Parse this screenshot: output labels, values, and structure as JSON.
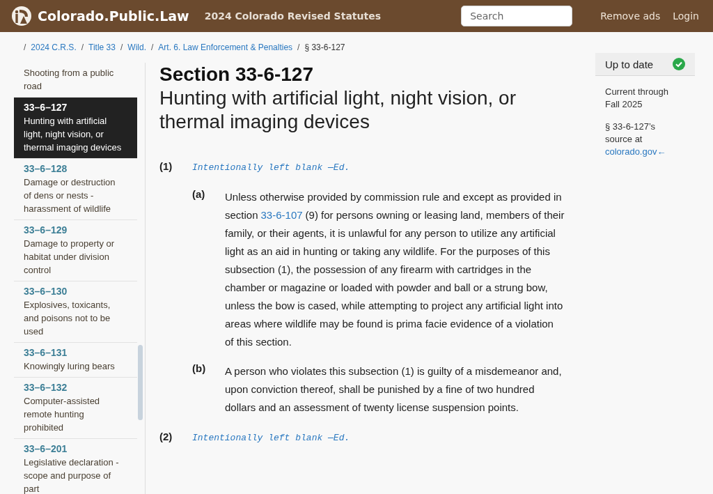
{
  "header": {
    "site_name": "Colorado.Public.Law",
    "subtitle": "2024 Colorado Revised Statutes",
    "search": {
      "placeholder": "Search"
    },
    "links": [
      "Remove ads",
      "Login"
    ]
  },
  "breadcrumb": {
    "separator": "/",
    "links": [
      "2024 C.R.S.",
      "Title 33",
      "Wild.",
      "Art. 6. Law Enforcement & Penalties"
    ],
    "current": "§ 33-6-127"
  },
  "sidebar": {
    "items": [
      {
        "title": "Shooting from a public road",
        "selected": false
      },
      {
        "number": "33–6–127",
        "title": "Hunting with artificial light, night vision, or thermal imaging devices",
        "selected": true
      },
      {
        "number": "33–6–128",
        "title": "Damage or destruction of dens or nests - harassment of wildlife",
        "selected": false
      },
      {
        "number": "33–6–129",
        "title": "Damage to property or habitat under division control",
        "selected": false
      },
      {
        "number": "33–6–130",
        "title": "Explosives, toxicants, and poisons not to be used",
        "selected": false
      },
      {
        "number": "33–6–131",
        "title": "Knowingly luring bears",
        "selected": false
      },
      {
        "number": "33–6–132",
        "title": "Computer-assisted remote hunting prohibited",
        "selected": false
      },
      {
        "number": "33–6–201",
        "title": "Legislative declaration - scope and purpose of part",
        "selected": false
      }
    ]
  },
  "section": {
    "heading": "Section 33-6-127",
    "title": "Hunting with artificial light, night vision, or thermal imaging devices",
    "subsections": [
      {
        "label": "(1)",
        "note": "Intentionally left blank —Ed.",
        "paragraphs": [
          {
            "label": "(a)",
            "before": "Unless otherwise provided by commission rule and except as provided in section",
            "link": "33-6-107",
            "after": "(9) for persons owning or leasing land, members of their family, or their agents, it is unlawful for any person to utilize any artificial light as an aid in hunting or taking any wildlife. For the purposes of this subsection (1), the possession of any firearm with cartridges in the chamber or magazine or loaded with powder and ball or a strung bow, unless the bow is cased, while attempting to project any artificial light into areas where wildlife may be found is prima facie evidence of a violation of this section."
          },
          {
            "label": "(b)",
            "before": "A person who violates this subsection (1) is guilty of a misdemeanor and, upon conviction thereof, shall be punished by a fine of two hundred dollars and an assessment of twenty license suspension points."
          }
        ]
      },
      {
        "label": "(2)",
        "note": "Intentionally left blank —Ed."
      }
    ]
  },
  "status": {
    "label": "Up to date",
    "current": true,
    "currency": "Current through Fall 2025",
    "source_prefix": "§ 33-6-127’s source at",
    "source_link": "colorado.gov",
    "source_arrow": "←"
  }
}
